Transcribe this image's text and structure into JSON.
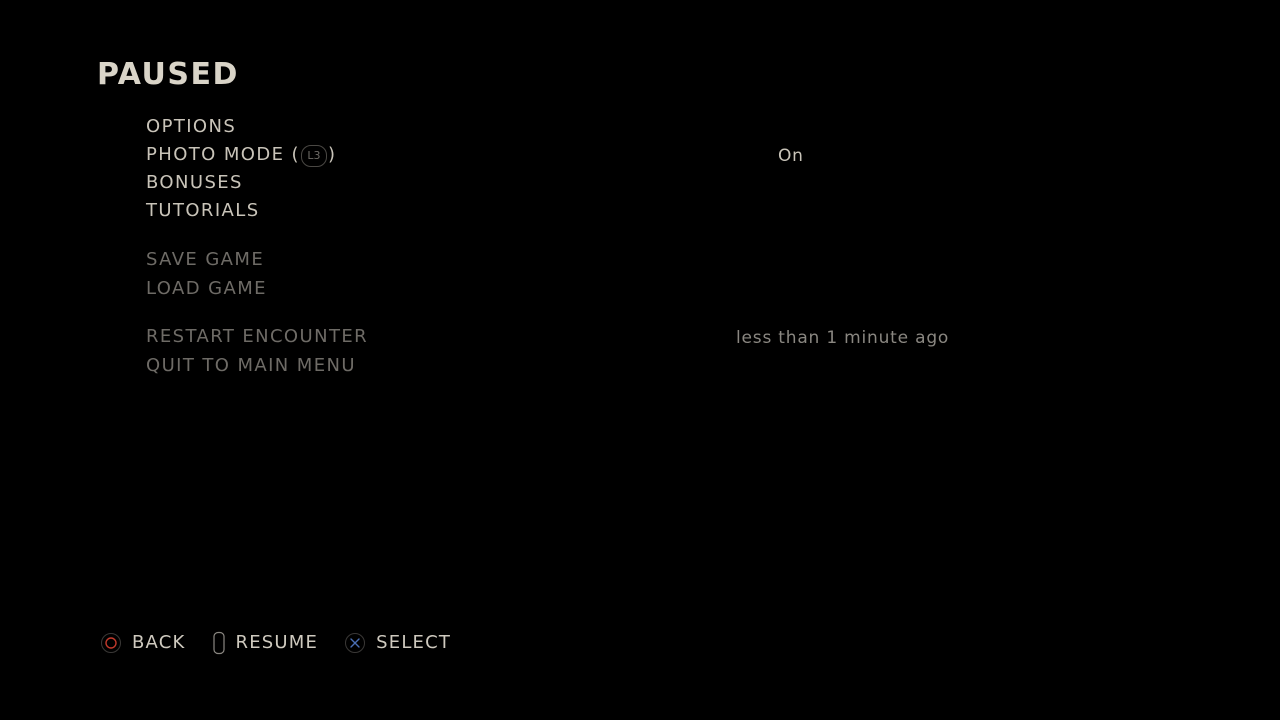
{
  "title": "PAUSED",
  "menu": {
    "options": "OPTIONS",
    "photo_mode": "PHOTO MODE",
    "photo_mode_open": "(",
    "photo_mode_button": "L3",
    "photo_mode_close": ")",
    "bonuses": "BONUSES",
    "tutorials": "TUTORIALS",
    "save_game": "SAVE GAME",
    "load_game": "LOAD GAME",
    "restart_encounter": "RESTART ENCOUNTER",
    "quit_to_main_menu": "QUIT TO MAIN MENU"
  },
  "values": {
    "photo_mode_value": "On",
    "restart_time": "less than 1 minute ago"
  },
  "footer": {
    "back": "BACK",
    "resume": "RESUME",
    "select": "SELECT"
  },
  "colors": {
    "circle_button": "#c0392b",
    "cross_button": "#4a6fb5",
    "options_button": "#8a8781"
  }
}
